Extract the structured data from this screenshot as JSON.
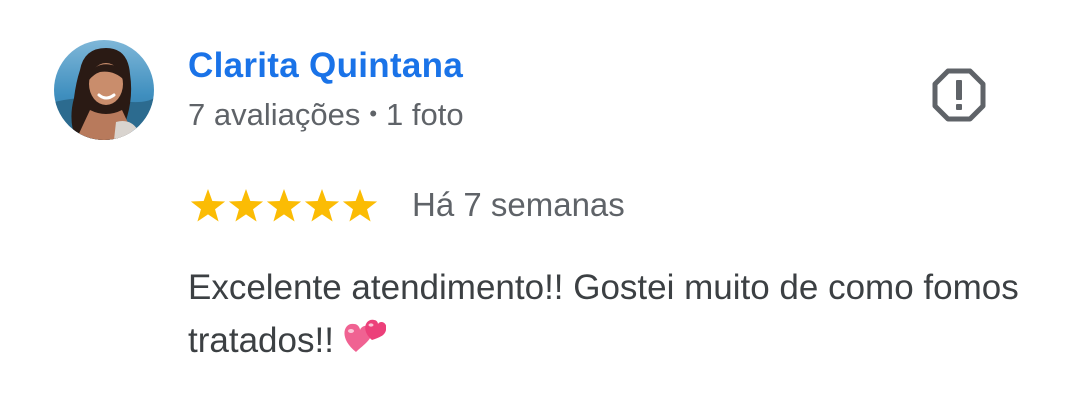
{
  "review": {
    "author": {
      "name": "Clarita Quintana",
      "reviews_count": "7 avaliações",
      "separator": "•",
      "photos_count": "1 foto"
    },
    "rating": {
      "stars": 5,
      "max_stars": 5,
      "star_color": "#fbbc04"
    },
    "date": "Há 7 semanas",
    "text": "Excelente atendimento!! Gostei muito de como fomos tratados!!",
    "emoji": "two-hearts-emoji"
  },
  "colors": {
    "name_link": "#1a73e8",
    "secondary_text": "#5f6368",
    "body_text": "#3c4043",
    "icon": "#5f6368"
  },
  "icons": {
    "report": "report-octagon-icon"
  }
}
